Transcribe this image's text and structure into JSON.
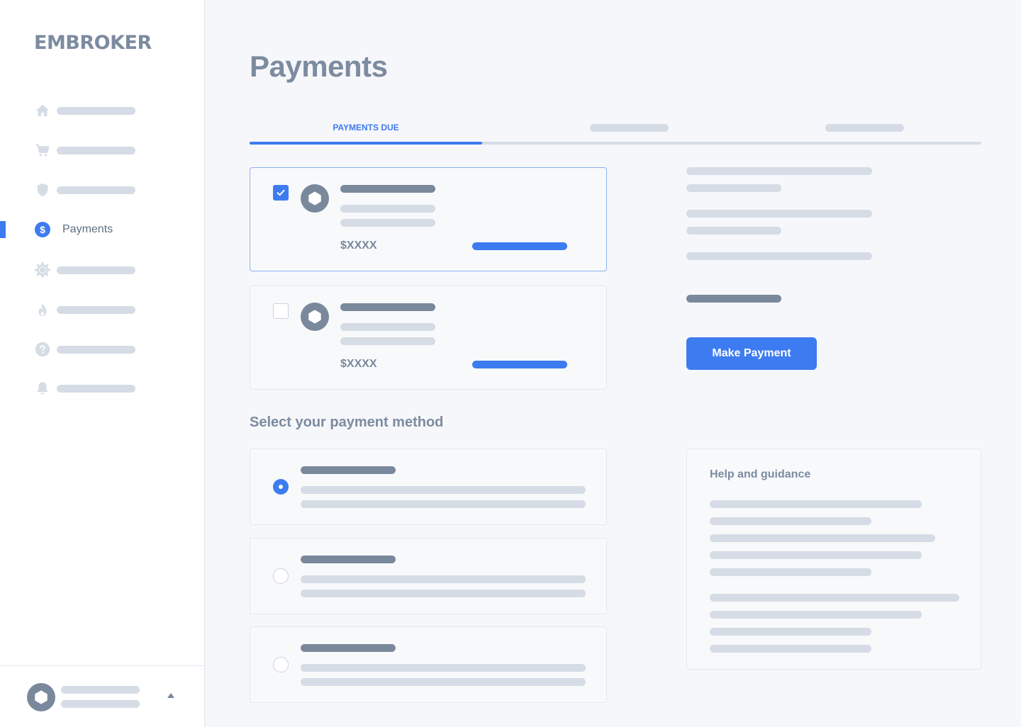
{
  "brand": {
    "logo_text": "EMBROKER"
  },
  "sidebar": {
    "items": [
      {
        "icon": "home-icon",
        "label": ""
      },
      {
        "icon": "cart-icon",
        "label": ""
      },
      {
        "icon": "shield-icon",
        "label": ""
      },
      {
        "icon": "dollar-icon",
        "label": "Payments",
        "active": true
      },
      {
        "icon": "gear-icon",
        "label": ""
      },
      {
        "icon": "flame-icon",
        "label": ""
      },
      {
        "icon": "help-icon",
        "label": ""
      },
      {
        "icon": "bell-icon",
        "label": ""
      }
    ]
  },
  "page": {
    "title": "Payments"
  },
  "tabs": [
    {
      "label": "PAYMENTS DUE",
      "active": true
    },
    {
      "label": ""
    },
    {
      "label": ""
    }
  ],
  "payments": [
    {
      "amount": "$XXXX",
      "checked": true
    },
    {
      "amount": "$XXXX",
      "checked": false
    }
  ],
  "payment_method": {
    "title": "Select your payment method",
    "options": [
      {
        "selected": true
      },
      {
        "selected": false
      },
      {
        "selected": false
      }
    ]
  },
  "actions": {
    "make_payment_label": "Make Payment"
  },
  "help": {
    "title": "Help and guidance"
  },
  "colors": {
    "accent": "#3d7bf0",
    "placeholder": "#d5dce5",
    "placeholder_dark": "#7a889c"
  }
}
